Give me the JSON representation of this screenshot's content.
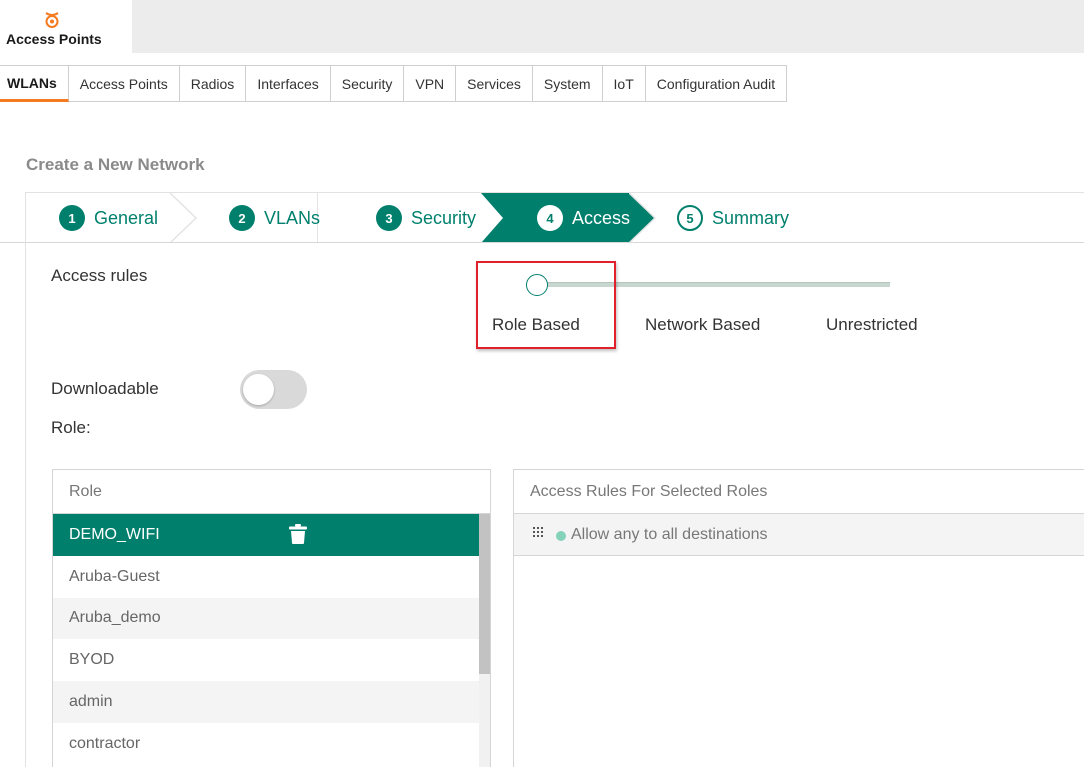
{
  "app": {
    "title": "Access Points",
    "icon": "access-point-icon",
    "accent": "#f47b20"
  },
  "tabs": [
    {
      "label": "WLANs",
      "active": true
    },
    {
      "label": "Access Points"
    },
    {
      "label": "Radios"
    },
    {
      "label": "Interfaces"
    },
    {
      "label": "Security"
    },
    {
      "label": "VPN"
    },
    {
      "label": "Services"
    },
    {
      "label": "System"
    },
    {
      "label": "IoT"
    },
    {
      "label": "Configuration Audit"
    }
  ],
  "page": {
    "title": "Create a New Network"
  },
  "wizard": {
    "color": "#007f6d",
    "steps": [
      {
        "num": "1",
        "label": "General",
        "state": "done"
      },
      {
        "num": "2",
        "label": "VLANs",
        "state": "done"
      },
      {
        "num": "3",
        "label": "Security",
        "state": "done"
      },
      {
        "num": "4",
        "label": "Access",
        "state": "active"
      },
      {
        "num": "5",
        "label": "Summary",
        "state": "pending"
      }
    ]
  },
  "access_rules": {
    "label": "Access rules",
    "options": [
      "Role Based",
      "Network Based",
      "Unrestricted"
    ],
    "selected": "Role Based"
  },
  "downloadable_role": {
    "label_line1": "Downloadable",
    "label_line2": "Role:",
    "enabled": false
  },
  "roles_table": {
    "header": "Role",
    "rows": [
      "DEMO_WIFI",
      "Aruba-Guest",
      "Aruba_demo",
      "BYOD",
      "admin",
      "contractor"
    ],
    "selected": "DEMO_WIFI"
  },
  "rules_table": {
    "header": "Access Rules For Selected Roles",
    "rules": [
      "Allow any to all destinations"
    ]
  }
}
